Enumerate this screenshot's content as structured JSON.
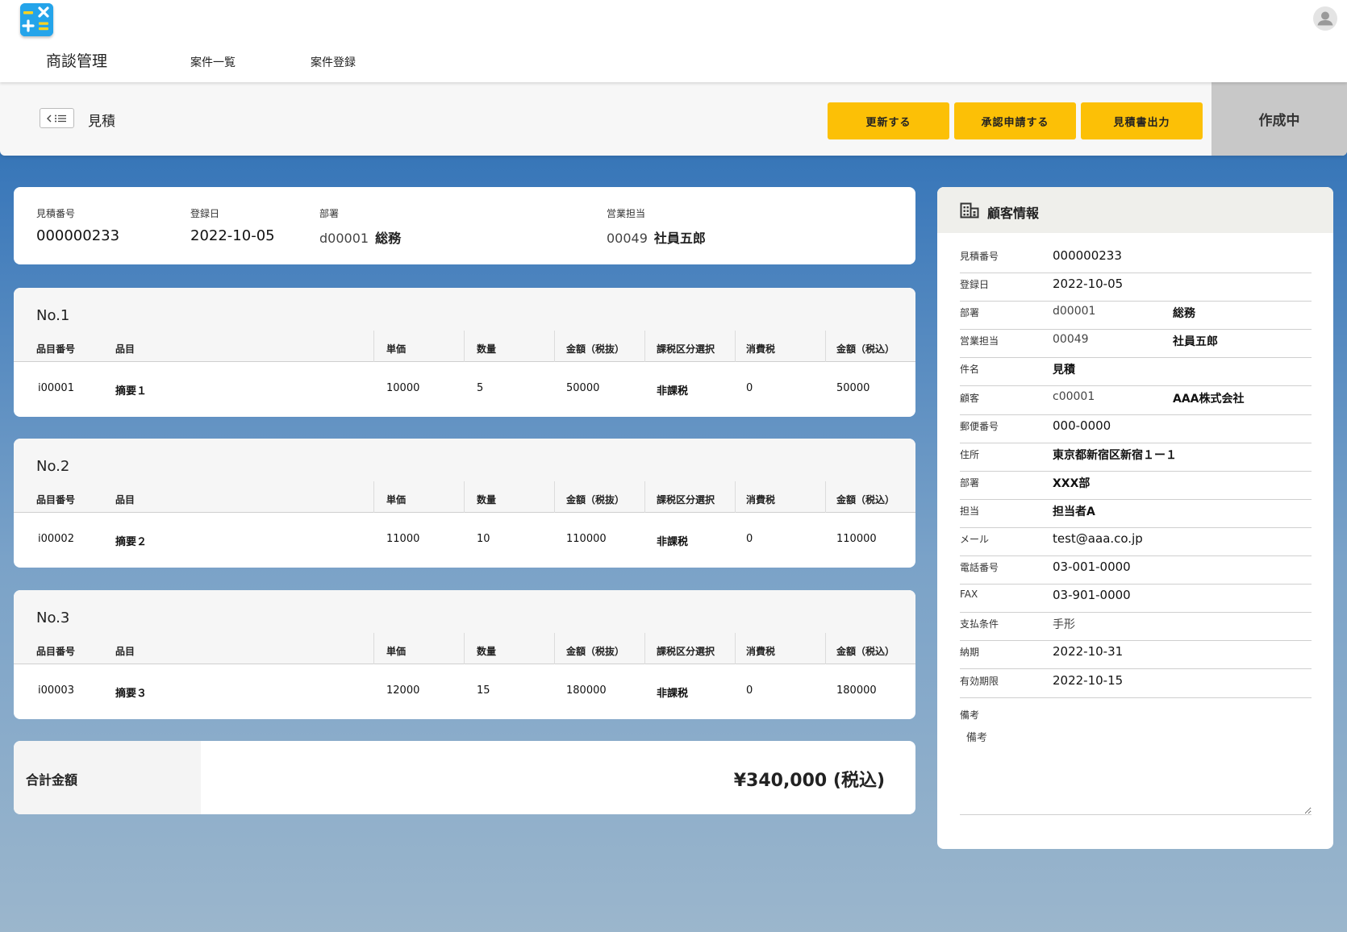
{
  "app": {
    "title": "商談管理",
    "nav": {
      "list": "案件一覧",
      "register": "案件登録"
    }
  },
  "action_bar": {
    "title": "見積",
    "buttons": {
      "update": "更新する",
      "approve": "承認申請する",
      "print": "見積書出力"
    },
    "status": "作成中"
  },
  "summary": {
    "estimate_no_label": "見積番号",
    "estimate_no": "000000233",
    "date_label": "登録日",
    "date": "2022-10-05",
    "dept_label": "部署",
    "dept_code": "d00001",
    "dept_name": "総務",
    "sales_label": "営業担当",
    "sales_code": "00049",
    "sales_name": "社員五郎"
  },
  "columns": [
    "品目番号",
    "品目",
    "単価",
    "数量",
    "金額（税抜）",
    "課税区分選択",
    "消費税",
    "金額（税込）"
  ],
  "items": [
    {
      "no": "No.1",
      "item_no": "i00001",
      "name": "摘要１",
      "unit_price": "10000",
      "qty": "5",
      "amount_ex": "50000",
      "tax_type": "非課税",
      "tax": "0",
      "amount_in": "50000"
    },
    {
      "no": "No.2",
      "item_no": "i00002",
      "name": "摘要２",
      "unit_price": "11000",
      "qty": "10",
      "amount_ex": "110000",
      "tax_type": "非課税",
      "tax": "0",
      "amount_in": "110000"
    },
    {
      "no": "No.3",
      "item_no": "i00003",
      "name": "摘要３",
      "unit_price": "12000",
      "qty": "15",
      "amount_ex": "180000",
      "tax_type": "非課税",
      "tax": "0",
      "amount_in": "180000"
    }
  ],
  "total": {
    "label": "合計金額",
    "value": "¥340,000 (税込)"
  },
  "customer": {
    "title": "顧客情報",
    "rows": [
      {
        "label": "見積番号",
        "value": "000000233"
      },
      {
        "label": "登録日",
        "value": "2022-10-05"
      },
      {
        "label": "部署",
        "value": "d00001",
        "value2": "総務"
      },
      {
        "label": "営業担当",
        "value": "00049",
        "value2": "社員五郎"
      },
      {
        "label": "件名",
        "value": "見積"
      },
      {
        "label": "顧客",
        "value": "c00001",
        "value2": "AAA株式会社"
      },
      {
        "label": "郵便番号",
        "value": "000-0000"
      },
      {
        "label": "住所",
        "value": "東京都新宿区新宿１ー１"
      },
      {
        "label": "部署",
        "value": "XXX部"
      },
      {
        "label": "担当",
        "value": "担当者A"
      },
      {
        "label": "メール",
        "value": "test@aaa.co.jp"
      },
      {
        "label": "電話番号",
        "value": "03-001-0000"
      },
      {
        "label": "FAX",
        "value": "03-901-0000"
      },
      {
        "label": "支払条件",
        "value": "手形"
      },
      {
        "label": "納期",
        "value": "2022-10-31"
      },
      {
        "label": "有効期限",
        "value": "2022-10-15"
      }
    ],
    "remarks_label": "備考",
    "remarks_placeholder": "備考"
  },
  "icons": {
    "logo": "calculator-icon",
    "avatar": "user-avatar-icon",
    "back": "back-list-icon",
    "building": "building-icon"
  },
  "colors": {
    "accent": "#fcc006",
    "status_bg": "#c8c8c8",
    "bg_top": "#1e66ae",
    "bg_bottom": "#9bb6cc"
  }
}
